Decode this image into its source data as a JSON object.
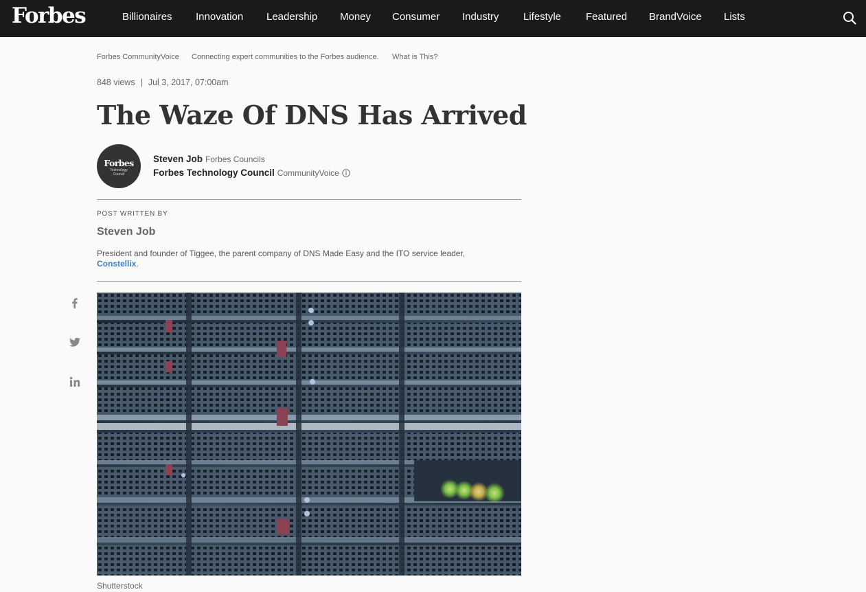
{
  "header": {
    "logo": "Forbes",
    "nav": [
      "Billionaires",
      "Innovation",
      "Leadership",
      "Money",
      "Consumer",
      "Industry",
      "Lifestyle",
      "Featured",
      "BrandVoice",
      "Lists"
    ],
    "search_icon": "search-icon"
  },
  "breadcrumb": {
    "section": "Forbes CommunityVoice",
    "tagline": "Connecting expert communities to the Forbes audience.",
    "what_is": "What is This?"
  },
  "article": {
    "views": "848 views",
    "separator": "|",
    "date": "Jul 3, 2017, 07:00am",
    "title": "The Waze Of DNS Has Arrived"
  },
  "author": {
    "avatar_logo": "Forbes",
    "avatar_sub1": "Technology",
    "avatar_sub2": "Council",
    "name": "Steven Job",
    "name_tag": "Forbes Councils",
    "council": "Forbes Technology Council",
    "council_tag": "CommunityVoice"
  },
  "bio": {
    "label": "POST WRITTEN BY",
    "name": "Steven Job",
    "text": "President and founder of Tiggee, the parent company of DNS Made Easy and the ITO service leader,",
    "link": "Constellix",
    "end": "."
  },
  "share": {
    "icons": [
      "facebook-icon",
      "twitter-icon",
      "linkedin-icon"
    ]
  },
  "image": {
    "caption": "Shutterstock"
  },
  "colors": {
    "topbar": "#1a1a1a",
    "link": "#3a7fc4",
    "background": "#fafafa"
  }
}
